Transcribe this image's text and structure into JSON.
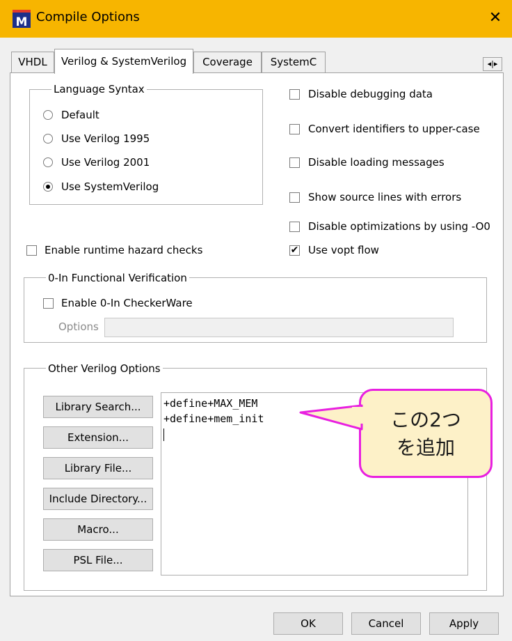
{
  "window": {
    "title": "Compile Options",
    "icon_letter": "M",
    "close_glyph": "✕"
  },
  "tabs": [
    {
      "label": "VHDL",
      "active": false
    },
    {
      "label": "Verilog & SystemVerilog",
      "active": true
    },
    {
      "label": "Coverage",
      "active": false
    },
    {
      "label": "SystemC",
      "active": false
    }
  ],
  "tab_scroll_glyph": "◂|▸",
  "language_syntax": {
    "label": "Language Syntax",
    "options": [
      {
        "label": "Default",
        "checked": false
      },
      {
        "label": "Use Verilog 1995",
        "checked": false
      },
      {
        "label": "Use Verilog 2001",
        "checked": false
      },
      {
        "label": "Use SystemVerilog",
        "checked": true
      }
    ]
  },
  "right_checks": [
    {
      "label": "Disable debugging data",
      "checked": false
    },
    {
      "label": "Convert identifiers to upper-case",
      "checked": false
    },
    {
      "label": "Disable loading messages",
      "checked": false
    },
    {
      "label": "Show source lines with errors",
      "checked": false
    },
    {
      "label": "Disable optimizations by using -O0",
      "checked": false
    },
    {
      "label": "Use vopt flow",
      "checked": true
    }
  ],
  "hazard_check": {
    "label": "Enable runtime hazard checks",
    "checked": false
  },
  "zero_in": {
    "label": "0-In Functional Verification",
    "enable_label": "Enable 0-In CheckerWare",
    "options_label": "Options",
    "options_value": ""
  },
  "other_verilog": {
    "label": "Other Verilog Options",
    "buttons": [
      "Library Search...",
      "Extension...",
      "Library File...",
      "Include Directory...",
      "Macro...",
      "PSL File..."
    ],
    "text_lines": [
      "+define+MAX_MEM",
      "+define+mem_init"
    ]
  },
  "callout": {
    "line1": "この2つ",
    "line2": "を追加",
    "border_color": "#e81fe0",
    "fill_color": "#fdf1c8"
  },
  "bottom_buttons": {
    "ok": "OK",
    "cancel": "Cancel",
    "apply": "Apply"
  },
  "colors": {
    "titlebar": "#f7b500"
  }
}
